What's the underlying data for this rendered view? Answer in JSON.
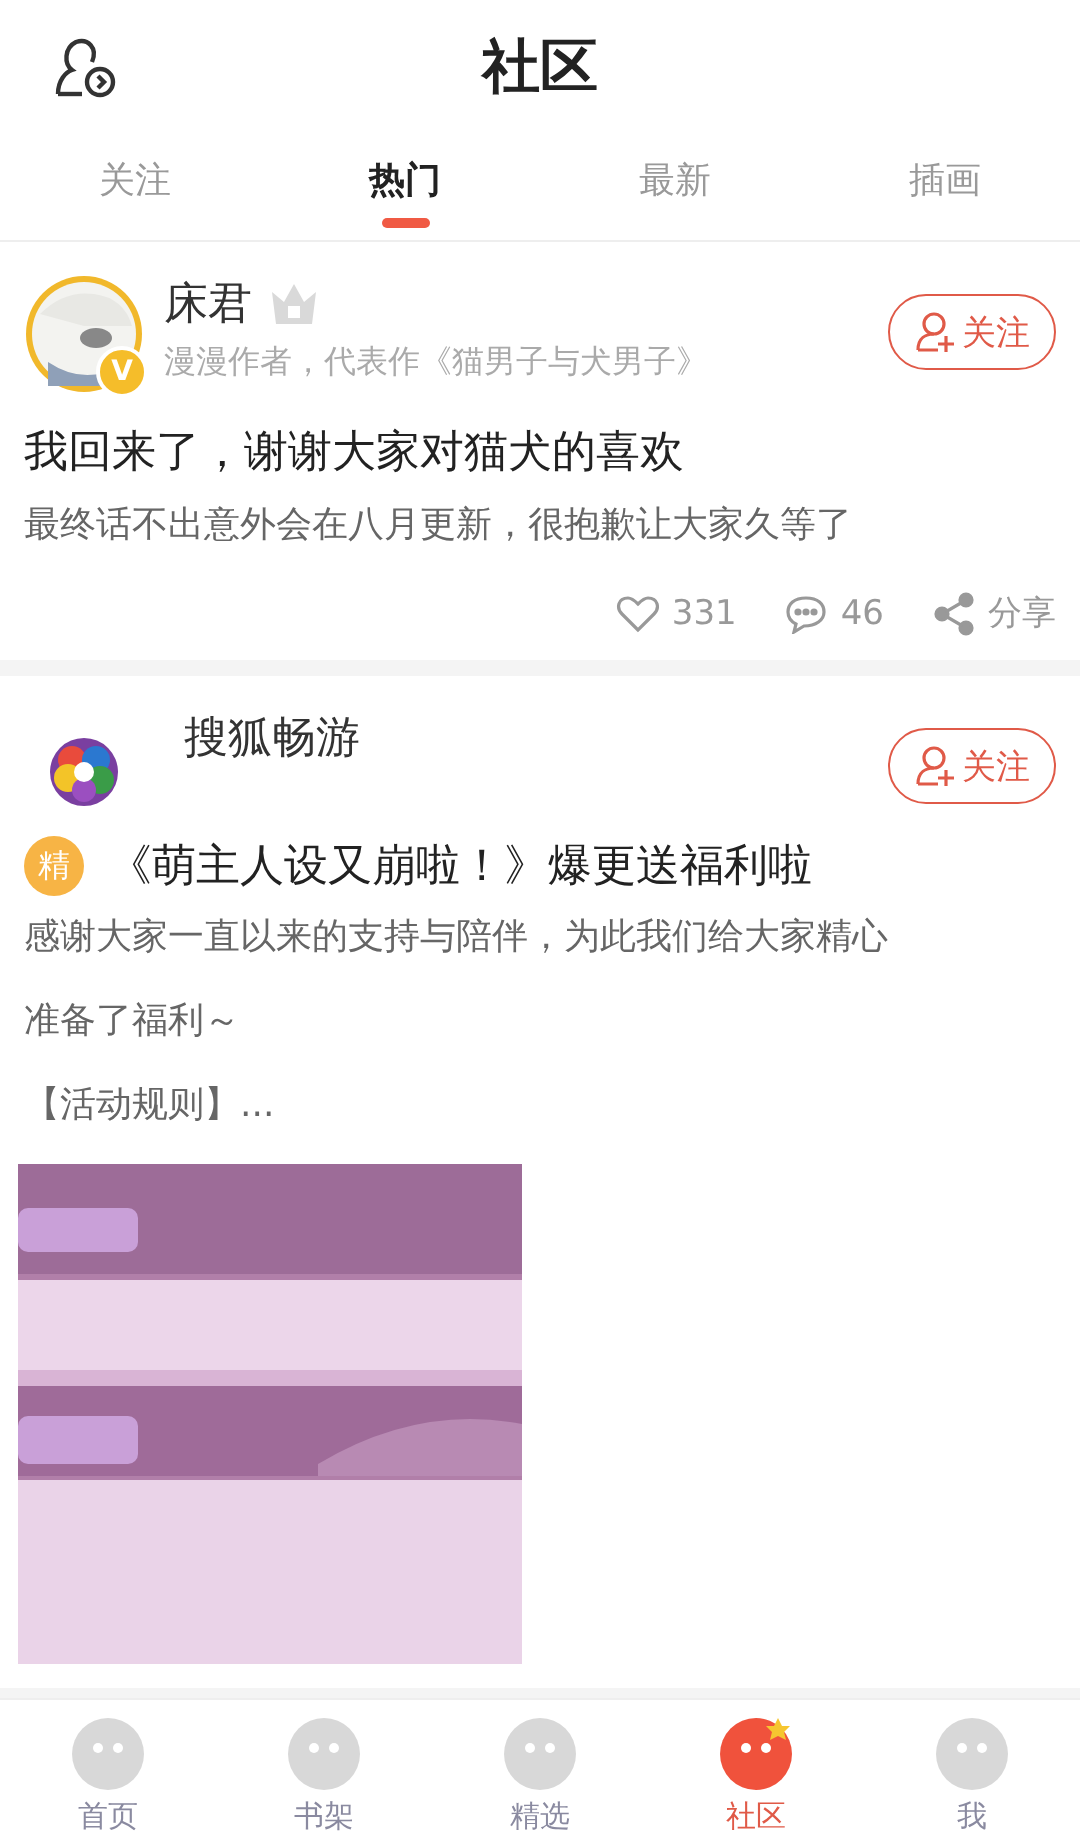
{
  "header": {
    "title": "社区"
  },
  "tabs": [
    {
      "label": "关注",
      "selected": false
    },
    {
      "label": "热门",
      "selected": true
    },
    {
      "label": "最新",
      "selected": false
    },
    {
      "label": "插画",
      "selected": false
    }
  ],
  "posts": [
    {
      "kind": "author",
      "name": "床君",
      "verified_badge": "V",
      "subtitle": "漫漫作者，代表作《猫男子与犬男子》",
      "follow": "关注",
      "title": "我回来了，谢谢大家对猫犬的喜欢",
      "body": [
        "最终话不出意外会在八月更新，很抱歉让大家久等了"
      ],
      "likes": "331",
      "comments": "46",
      "share": "分享"
    },
    {
      "kind": "brand",
      "name": "搜狐畅游",
      "follow": "关注",
      "badge": "精",
      "title": "《萌主人设又崩啦！》爆更送福利啦",
      "body": [
        "感谢大家一直以来的支持与陪伴，为此我们给大家精心",
        "准备了福利～",
        "【活动规则】..."
      ],
      "image": {
        "kind": "picture"
      }
    }
  ],
  "bottom_nav": [
    {
      "label": "首页",
      "selected": false
    },
    {
      "label": "书架",
      "selected": false
    },
    {
      "label": "精选",
      "selected": false
    },
    {
      "label": "社区",
      "selected": true
    },
    {
      "label": "我",
      "selected": false
    }
  ]
}
